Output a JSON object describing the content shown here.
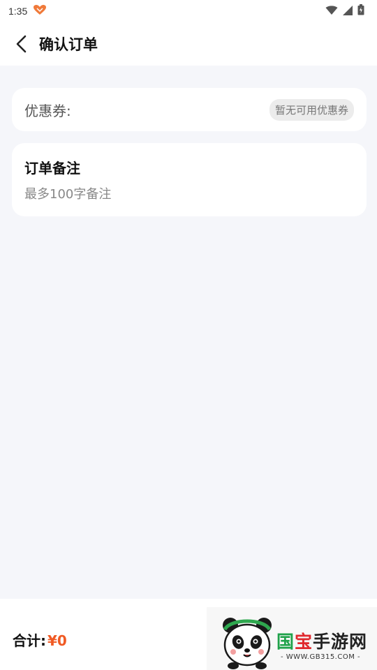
{
  "status_bar": {
    "time": "1:35"
  },
  "nav": {
    "title": "确认订单"
  },
  "coupon": {
    "label": "优惠券:",
    "badge": "暂无可用优惠券"
  },
  "remark": {
    "title": "订单备注",
    "placeholder": "最多100字备注"
  },
  "footer": {
    "total_label": "合计:",
    "total_value": "¥0"
  },
  "watermark": {
    "brand_part1": "国",
    "brand_part2": "宝",
    "brand_part3": "手游网",
    "url": "- WWW.GB315.COM -"
  },
  "colors": {
    "accent": "#f05a24",
    "background": "#f5f6fa"
  }
}
